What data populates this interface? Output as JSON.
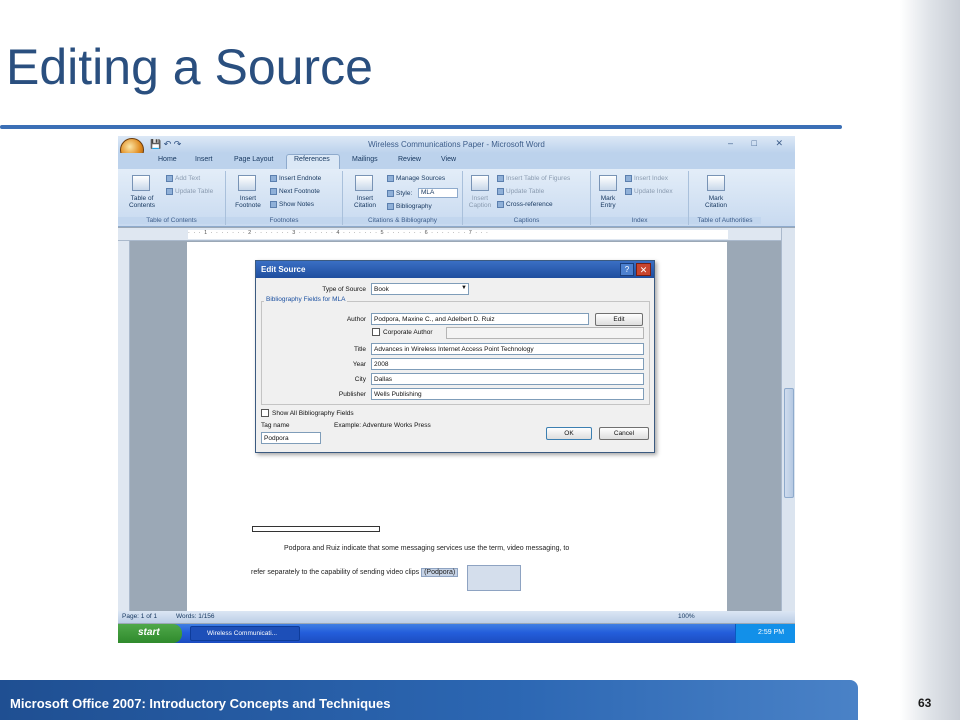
{
  "slide": {
    "title": "Editing a Source",
    "footer": "Microsoft Office 2007: Introductory Concepts and Techniques",
    "page_number": "63"
  },
  "word": {
    "window_title": "Wireless Communications Paper - Microsoft Word",
    "tabs": [
      "Home",
      "Insert",
      "Page Layout",
      "References",
      "Mailings",
      "Review",
      "View"
    ],
    "active_tab": "References",
    "ribbon": {
      "toc": {
        "big": "Table of Contents",
        "add_text": "Add Text",
        "update_table": "Update Table",
        "label": "Table of Contents"
      },
      "footnotes": {
        "big": "Insert Footnote",
        "insert_endnote": "Insert Endnote",
        "next_footnote": "Next Footnote",
        "show_notes": "Show Notes",
        "label": "Footnotes"
      },
      "citations": {
        "big": "Insert Citation",
        "manage_sources": "Manage Sources",
        "style_label": "Style:",
        "style_value": "MLA",
        "bibliography": "Bibliography",
        "label": "Citations & Bibliography"
      },
      "captions": {
        "big": "Insert Caption",
        "insert_tof": "Insert Table of Figures",
        "update_table": "Update Table",
        "cross_reference": "Cross-reference",
        "label": "Captions"
      },
      "index": {
        "big": "Mark Entry",
        "insert_index": "Insert Index",
        "update_index": "Update Index",
        "label": "Index"
      },
      "toa": {
        "big": "Mark Citation",
        "label": "Table of Authorities"
      }
    },
    "document": {
      "line1": "Podpora and Ruiz indicate that some messaging services use the term, video messaging, to",
      "line2": "refer separately to the capability of sending video clips",
      "citation": "(Podpora)"
    },
    "status": {
      "page": "Page: 1 of 1",
      "words": "Words: 1/156",
      "zoom": "100%"
    },
    "taskbar": {
      "start": "start",
      "task": "Wireless Communicati...",
      "clock": "2:59 PM"
    }
  },
  "dialog": {
    "title": "Edit Source",
    "type_label": "Type of Source",
    "type_value": "Book",
    "group_label": "Bibliography Fields for MLA",
    "fields": [
      {
        "label": "Author",
        "value": "Podpora, Maxine C., and Adelbert D. Ruiz"
      },
      {
        "label": "Title",
        "value": "Advances in Wireless Internet Access Point Technology"
      },
      {
        "label": "Year",
        "value": "2008"
      },
      {
        "label": "City",
        "value": "Dallas"
      },
      {
        "label": "Publisher",
        "value": "Wells Publishing"
      }
    ],
    "corporate_author": "Corporate Author",
    "edit_button": "Edit",
    "show_all": "Show All Bibliography Fields",
    "tag_label": "Tag name",
    "tag_value": "Podpora",
    "example": "Example: Adventure Works Press",
    "ok": "OK",
    "cancel": "Cancel"
  }
}
